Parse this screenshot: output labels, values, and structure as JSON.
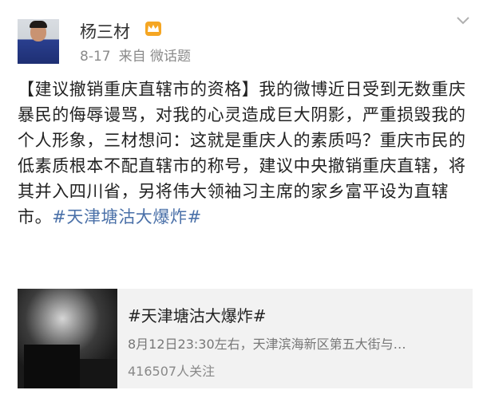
{
  "post": {
    "author": "杨三材",
    "date": "8-17",
    "source": "来自 微话题",
    "badge_icon": "crown-icon",
    "badge_color": "#f5a623",
    "text_main": "【建议撤销重庆直辖市的资格】我的微博近日受到无数重庆暴民的侮辱谩骂，对我的心灵造成巨大阴影，严重损毁我的个人形象，三材想问：这就是重庆人的素质吗？重庆市民的低素质根本不配直辖市的称号，建议中央撤销重庆直辖，将其并入四川省，另将伟大领袖习主席的家乡富平设为直辖市。",
    "hashtag": "#天津塘沽大爆炸#",
    "hashtag_color": "#4a70a8"
  },
  "topic_card": {
    "title": "#天津塘沽大爆炸#",
    "desc": "8月12日23:30左右，天津滨海新区第五大街与…",
    "followers": "416507人关注"
  }
}
